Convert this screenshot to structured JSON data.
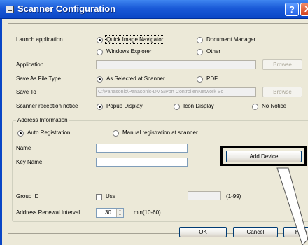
{
  "window": {
    "title": "Scanner Configuration",
    "help_glyph": "?",
    "close_glyph": "X"
  },
  "launch": {
    "label": "Launch application",
    "options": [
      "Quick Image Navigator",
      "Document Manager",
      "Windows Explorer",
      "Other"
    ],
    "selected": "Quick Image Navigator"
  },
  "application": {
    "label": "Application",
    "value": "",
    "browse": "Browse"
  },
  "file_type": {
    "label": "Save As File Type",
    "options": [
      "As Selected at Scanner",
      "PDF"
    ],
    "selected": "As Selected at Scanner"
  },
  "save_to": {
    "label": "Save To",
    "value": "C:\\Panasonic\\Panasonic-DMS\\Port Controller\\Network Sc",
    "browse": "Browse"
  },
  "reception": {
    "label": "Scanner reception notice",
    "options": [
      "Popup Display",
      "Icon Display",
      "No Notice"
    ],
    "selected": "Popup Display"
  },
  "address": {
    "group_label": "Address Information",
    "options": [
      "Auto Registration",
      "Manual registration at scanner"
    ],
    "selected": "Auto Registration",
    "add_device": "Add Device",
    "name_label": "Name",
    "name_value": "",
    "key_name_label": "Key Name",
    "key_name_value": "",
    "group_id_label": "Group ID",
    "use_label": "Use",
    "group_id_value": "",
    "group_id_range": "(1-99)",
    "renewal_label": "Address Renewal Interval",
    "renewal_value": "30",
    "renewal_range": "min(10-60)"
  },
  "footer": {
    "ok": "OK",
    "cancel": "Cancel",
    "help": "Help"
  },
  "colors": {
    "titlebar": "#0a46c6",
    "dialog_bg": "#ece9d8",
    "highlight_border": "#000000"
  }
}
